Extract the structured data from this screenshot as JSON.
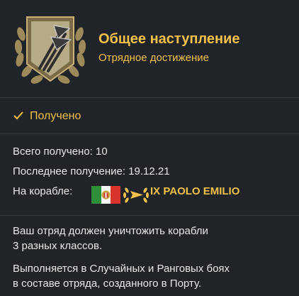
{
  "achievement": {
    "title": "Общее наступление",
    "subtitle": "Отрядное достижение",
    "medal_icon": "trident-medal-icon"
  },
  "status": {
    "icon": "checkmark-icon",
    "label": "Получено"
  },
  "stats": {
    "total_label": "Всего получено: 10",
    "last_label": "Последнее получение: 19.12.21",
    "ship_label": "На корабле:",
    "ship_flag_icon": "italy-flag-icon",
    "ship_class_icon": "cruiser-class-icon",
    "ship_name": "IX PAOLO EMILIO"
  },
  "description": {
    "line1": "Ваш отряд должен уничтожить корабли",
    "line2": "3 разных классов.",
    "line3": "Выполняется в Случайных и Ранговых боях",
    "line4": "в составе отряда, созданного в Порту."
  },
  "colors": {
    "accent": "#f2c14a",
    "background": "#202327",
    "text": "#e8e8e8"
  }
}
